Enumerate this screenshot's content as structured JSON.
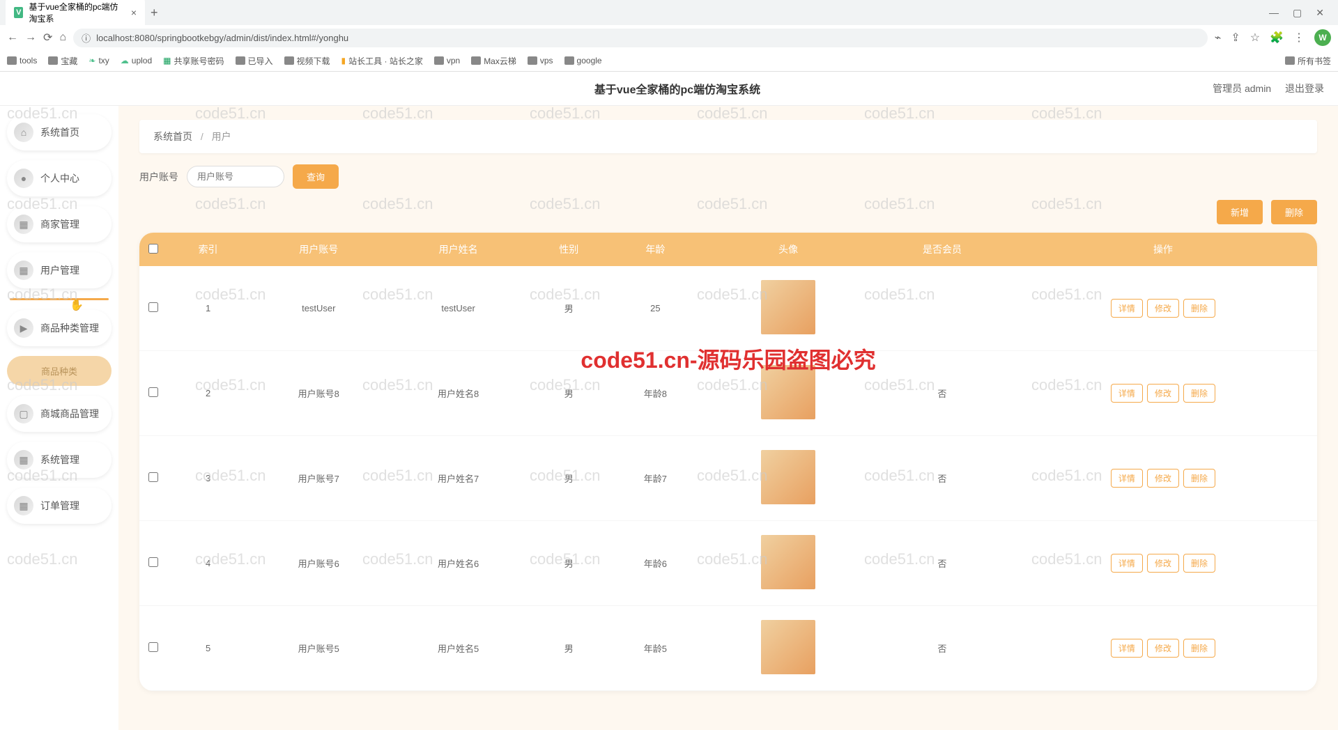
{
  "browser": {
    "tab_title": "基于vue全家桶的pc端仿淘宝系",
    "url": "localhost:8080/springbootkebgy/admin/dist/index.html#/yonghu",
    "profile_letter": "W",
    "bookmarks": [
      "tools",
      "宝藏",
      "txy",
      "uplod",
      "共享账号密码",
      "已导入",
      "视频下载",
      "站长工具 · 站长之家",
      "vpn",
      "Max云梯",
      "vps",
      "google"
    ],
    "bookmark_all": "所有书签"
  },
  "header": {
    "title": "基于vue全家桶的pc端仿淘宝系统",
    "role": "管理员 admin",
    "logout": "退出登录"
  },
  "sidebar": {
    "items": [
      {
        "label": "系统首页",
        "icon": "⌂"
      },
      {
        "label": "个人中心",
        "icon": "●"
      },
      {
        "label": "商家管理",
        "icon": "▦"
      },
      {
        "label": "用户管理",
        "icon": "▦"
      },
      {
        "label": "商品种类管理",
        "icon": "▶"
      },
      {
        "label": "商品种类",
        "sub": true
      },
      {
        "label": "商城商品管理",
        "icon": "▢"
      },
      {
        "label": "系统管理",
        "icon": "▦"
      },
      {
        "label": "订单管理",
        "icon": "▦"
      }
    ]
  },
  "breadcrumb": {
    "home": "系统首页",
    "current": "用户"
  },
  "search": {
    "label": "用户账号",
    "placeholder": "用户账号",
    "button": "查询"
  },
  "actions": {
    "add": "新增",
    "delete": "删除"
  },
  "table": {
    "headers": [
      "索引",
      "用户账号",
      "用户姓名",
      "性别",
      "年龄",
      "头像",
      "是否会员",
      "操作"
    ],
    "ops": {
      "detail": "详情",
      "edit": "修改",
      "del": "删除"
    },
    "rows": [
      {
        "idx": "1",
        "account": "testUser",
        "name": "testUser",
        "gender": "男",
        "age": "25",
        "member": ""
      },
      {
        "idx": "2",
        "account": "用户账号8",
        "name": "用户姓名8",
        "gender": "男",
        "age": "年龄8",
        "member": "否"
      },
      {
        "idx": "3",
        "account": "用户账号7",
        "name": "用户姓名7",
        "gender": "男",
        "age": "年龄7",
        "member": "否"
      },
      {
        "idx": "4",
        "account": "用户账号6",
        "name": "用户姓名6",
        "gender": "男",
        "age": "年龄6",
        "member": "否"
      },
      {
        "idx": "5",
        "account": "用户账号5",
        "name": "用户姓名5",
        "gender": "男",
        "age": "年龄5",
        "member": "否"
      }
    ]
  },
  "watermark": {
    "text": "code51.cn",
    "red": "code51.cn-源码乐园盗图必究"
  }
}
